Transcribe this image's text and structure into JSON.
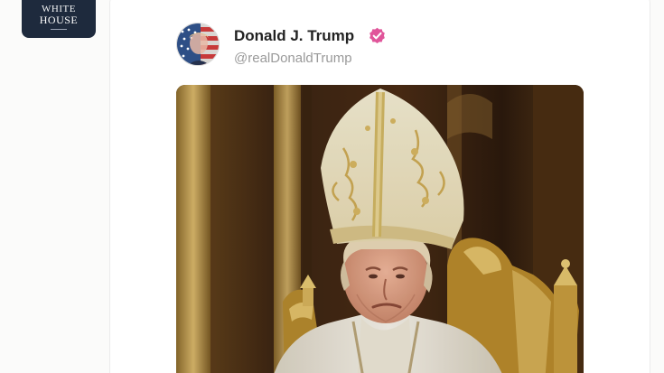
{
  "badge": {
    "line1": "WHITE",
    "line2": "HOUSE",
    "icon": "white-house-logo"
  },
  "post": {
    "author_name": "Donald J. Trump",
    "handle": "@realDonaldTrump",
    "verified_icon": "verified-check-icon",
    "verified_color": "#e0559a",
    "avatar_icon": "flag-portrait-avatar",
    "media_icon": "image-media"
  }
}
